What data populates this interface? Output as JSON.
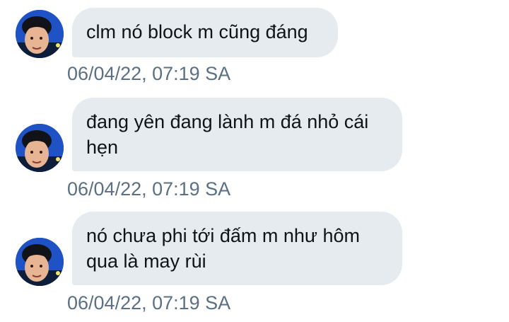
{
  "conversation": {
    "messages": [
      {
        "text": "clm nó block m cũng đáng",
        "timestamp": "06/04/22, 07:19 SA",
        "avatar_icon": "user-avatar"
      },
      {
        "text": "đang yên đang lành m đá nhỏ cái hẹn",
        "timestamp": "06/04/22, 07:19 SA",
        "avatar_icon": "user-avatar"
      },
      {
        "text": "nó chưa phi tới đấm m như hôm qua là may rùi",
        "timestamp": "06/04/22, 07:19 SA",
        "avatar_icon": "user-avatar"
      }
    ]
  },
  "colors": {
    "bubble_bg": "#e6ebf0",
    "message_text": "#0f1419",
    "timestamp_text": "#5b7083",
    "avatar_bg": "#1f52c4"
  }
}
